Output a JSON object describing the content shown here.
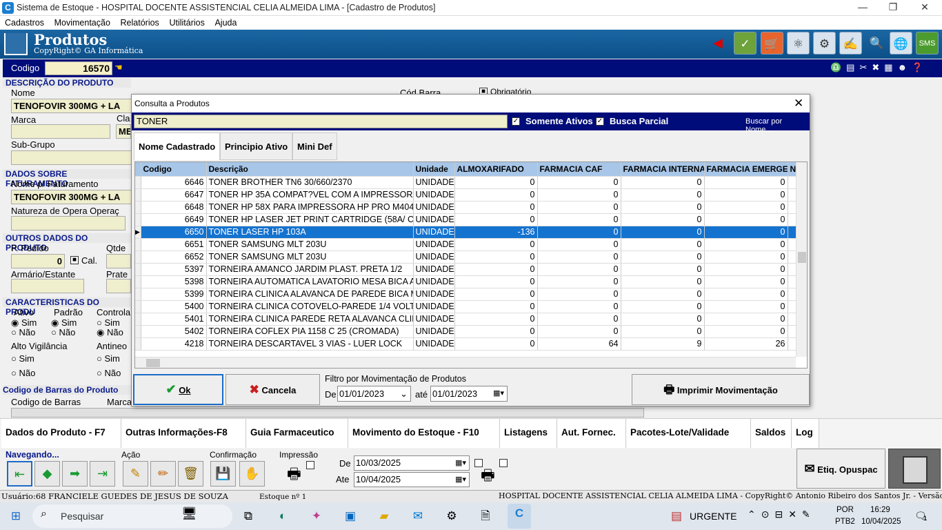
{
  "window": {
    "title": "Sistema de Estoque - HOSPITAL DOCENTE ASSISTENCIAL CELIA ALMEIDA LIMA - [Cadastro de Produtos]",
    "app_icon": "C"
  },
  "menu": [
    "Cadastros",
    "Movimentação",
    "Relatórios",
    "Utilitários",
    "Ajuda"
  ],
  "header": {
    "title": "Produtos",
    "subtitle": "CopyRight© GA Informática"
  },
  "codigo": {
    "label": "Codigo",
    "value": "16570"
  },
  "form": {
    "sec_desc": "DESCRIÇÃO DO PRODUTO",
    "nome_label": "Nome",
    "nome_value": "TENOFOVIR 300MG + LA",
    "codbarra_label": "Cód.Barra",
    "obrigatorio": "Obrigatório",
    "marca_label": "Marca",
    "cla_label": "Cla",
    "cla_value": "ME",
    "subgrupo_label": "Sub-Grupo",
    "sec_fat": "DADOS SOBRE FATURAMENTO",
    "nome_fat_label": "Nome p/ Faturamento",
    "nome_fat_value": "TENOFOVIR 300MG + LA",
    "natureza_label": "Natureza de Opera Operaç",
    "sec_outros": "OUTROS DADOS DO PRODUTO",
    "ppedido_label": "P. Pedido",
    "qtde_label": "Qtde",
    "ppedido_value": "0",
    "cal_label": "Cal.",
    "armario_label": "Armário/Estante",
    "prate_label": "Prate",
    "sec_carac": "CARACTERISTICAS DO PRODU",
    "ativo_label": "Ativo",
    "padrao_label": "Padrão",
    "controla_label": "Controla",
    "sim": "Sim",
    "nao": "Não",
    "alto_label": "Alto Vigilância",
    "antineo_label": "Antineo",
    "sec_codbarras": "Codigo de Barras do Produto",
    "codbarras_label": "Codigo de Barras",
    "marca2_label": "Marca"
  },
  "dialog": {
    "title": "Consulta a Produtos",
    "search_value": "TONER",
    "somente_ativos": "Somente Ativos",
    "busca_parcial": "Busca Parcial",
    "buscar_por": "Buscar por Nome...",
    "tabs": [
      "Nome Cadastrado",
      "Principio Ativo",
      "Mini Def"
    ],
    "columns": [
      "Codigo",
      "Descrição",
      "Unidade",
      "ALMOXARIFADO",
      "FARMACIA CAF",
      "FARMACIA INTERNAM",
      "FARMACIA EMERGEN",
      "NU"
    ],
    "rows": [
      [
        "6646",
        "TONER BROTHER TN6 30/660/2370",
        "UNIDADE",
        "0",
        "0",
        "0",
        "0"
      ],
      [
        "6647",
        "TONER HP 35A COMPAT?VEL COM A IMPRESSORA L",
        "UNIDADE",
        "0",
        "0",
        "0",
        "0"
      ],
      [
        "6648",
        "TONER HP 58X PARA IMPRESSORA HP PRO M404DW",
        "UNIDADE",
        "0",
        "0",
        "0",
        "0"
      ],
      [
        "6649",
        "TONER HP LASER JET PRINT CARTRIDGE (58A/ CF2",
        "UNIDADE",
        "0",
        "0",
        "0",
        "0"
      ],
      [
        "6650",
        "TONER LASER HP 103A",
        "UNIDADE",
        "-136",
        "0",
        "0",
        "0"
      ],
      [
        "6651",
        "TONER SAMSUNG MLT 203U",
        "UNIDADE",
        "0",
        "0",
        "0",
        "0"
      ],
      [
        "6652",
        "TONER SAMSUNG MLT 203U",
        "UNIDADE",
        "0",
        "0",
        "0",
        "0"
      ],
      [
        "5397",
        "TORNEIRA AMANCO JARDIM PLAST. PRETA 1/2",
        "UNIDADE",
        "0",
        "0",
        "0",
        "0"
      ],
      [
        "5398",
        "TORNEIRA AUTOMATICA LAVATORIO MESA BICA ALT",
        "UNIDADE",
        "0",
        "0",
        "0",
        "0"
      ],
      [
        "5399",
        "TORNEIRA CLINICA ALAVANCA DE PAREDE BICA MO",
        "UNIDADE",
        "0",
        "0",
        "0",
        "0"
      ],
      [
        "5400",
        "TORNEIRA CLINICA COTOVELO-PAREDE 1/4 VOLTA /",
        "UNIDADE",
        "0",
        "0",
        "0",
        "0"
      ],
      [
        "5401",
        "TORNEIRA CLINICA PAREDE RETA ALAVANCA CLINIC",
        "UNIDADE",
        "0",
        "0",
        "0",
        "0"
      ],
      [
        "5402",
        "TORNEIRA COFLEX PIA 1158 C 25 (CROMADA)",
        "UNIDADE",
        "0",
        "0",
        "0",
        "0"
      ],
      [
        "4218",
        "TORNEIRA DESCARTAVEL 3 VIAS - LUER  LOCK",
        "UNIDADE",
        "0",
        "64",
        "9",
        "26"
      ]
    ],
    "selected_index": 4,
    "ok": "Ok",
    "cancel": "Cancela",
    "filtro_label": "Filtro por Movimentação de Produtos",
    "de": "De",
    "ate": "até",
    "date_from": "01/01/2023",
    "date_to": "01/01/2023",
    "imprimir": "Imprimir Movimentação"
  },
  "bottom_tabs": [
    "Dados do Produto - F7",
    "Outras Informações-F8",
    "Guia Farmaceutico",
    "Movimento do Estoque - F10",
    "Listagens",
    "Aut. Fornec.",
    "Pacotes-Lote/Validade",
    "Saldos",
    "Log"
  ],
  "bottom": {
    "navegando": "Navegando...",
    "acao": "Ação",
    "confirmacao": "Confirmação",
    "impressao": "Impressão",
    "de": "De",
    "ate": "Ate",
    "date_de": "10/03/2025",
    "date_ate": "10/04/2025",
    "etiq": "Etiq. Opuspac"
  },
  "status": {
    "usuario": "Usuário:68 FRANCIELE GUEDES DE JESUS DE SOUZA",
    "estoque": "Estoque nº 1",
    "copyright": "HOSPITAL DOCENTE ASSISTENCIAL CELIA ALMEIDA LIMA - CopyRight© Antonio Ribeiro dos Santos Jr. - Versão: 2.1.6.10"
  },
  "taskbar": {
    "search": "Pesquisar",
    "urgente": "URGENTE",
    "lang1": "POR",
    "lang2": "PTB2",
    "time": "16:29",
    "date": "10/04/2025",
    "notif": "1"
  },
  "colors": {
    "header_blue": "#0c4f88",
    "navy": "#000c7a",
    "selected": "#1573d0",
    "field": "#efeecd"
  }
}
